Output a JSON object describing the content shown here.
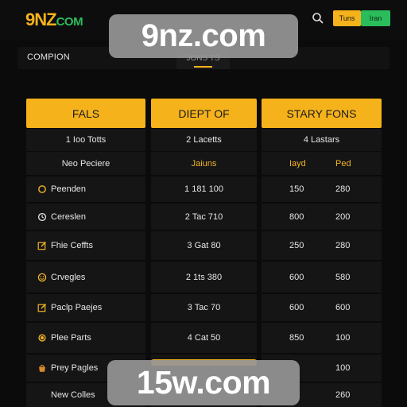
{
  "header": {
    "logo_main": "9NZ",
    "logo_suffix": "COM",
    "login_label": "Tuns",
    "join_label": "Iran",
    "search_icon": "search-icon"
  },
  "subbar": {
    "label": "COMPION",
    "tab_label": "JONS TS"
  },
  "columns": [
    "FALS",
    "DIEPT OF",
    "STARY FONS"
  ],
  "summary_row": {
    "c1": "1 Ioo Totts",
    "c2": "2 Lacetts",
    "c3": "4 Lastars"
  },
  "subheader_row": {
    "c1": "Neo Peciere",
    "c2": "Jaiuns",
    "c3a": "Iayd",
    "c3b": "Ped"
  },
  "rows": [
    {
      "icon": "circle-arrow-icon",
      "name": "Peenden",
      "mid": "1 181 100",
      "a": "150",
      "b": "280"
    },
    {
      "icon": "clock-icon",
      "name": "Cereslen",
      "mid": "2 Tac 710",
      "a": "800",
      "b": "200"
    },
    {
      "icon": "edit-icon",
      "name": "Fhie Ceffts",
      "mid": "3 Gat 80",
      "a": "250",
      "b": "280"
    },
    {
      "icon": "smile-icon",
      "name": "Crvegles",
      "mid": "2 1ts 380",
      "a": "600",
      "b": "580"
    },
    {
      "icon": "edit-icon",
      "name": "Paclp Paejes",
      "mid": "3 Tac 70",
      "a": "600",
      "b": "600"
    },
    {
      "icon": "coin-icon",
      "name": "Plee Parts",
      "mid": "4 Cat 50",
      "a": "850",
      "b": "100"
    },
    {
      "icon": "bag-icon",
      "name": "Prey Pagles",
      "mid": "",
      "a": "",
      "b": "100"
    },
    {
      "icon": "",
      "name": "New Colles",
      "mid": "",
      "a": "",
      "b": "260"
    }
  ],
  "watermarks": [
    "9nz.com",
    "15w.com"
  ],
  "colors": {
    "accent": "#f5b21b",
    "green": "#2bbd5b",
    "background": "#0b0b0c",
    "cell": "#151516"
  }
}
